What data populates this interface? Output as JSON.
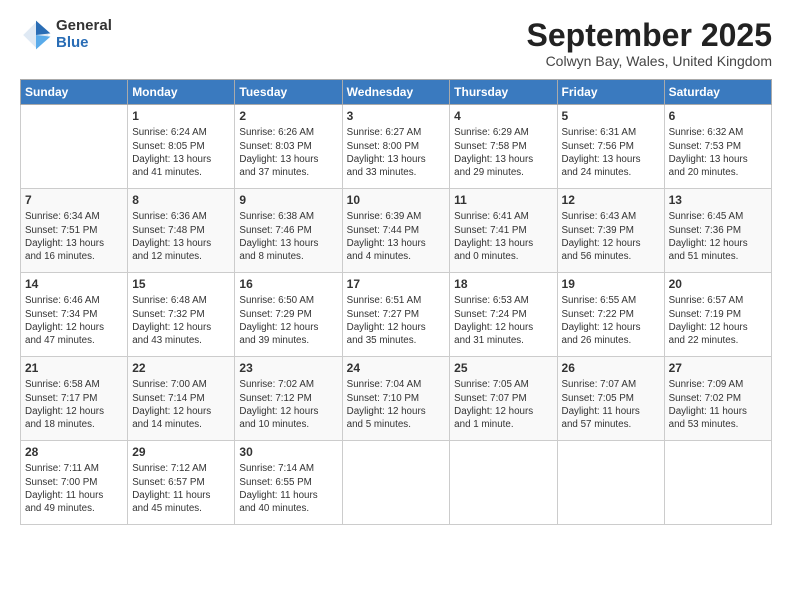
{
  "header": {
    "logo_general": "General",
    "logo_blue": "Blue",
    "month": "September 2025",
    "location": "Colwyn Bay, Wales, United Kingdom"
  },
  "weekdays": [
    "Sunday",
    "Monday",
    "Tuesday",
    "Wednesday",
    "Thursday",
    "Friday",
    "Saturday"
  ],
  "weeks": [
    [
      {
        "day": "",
        "content": ""
      },
      {
        "day": "1",
        "content": "Sunrise: 6:24 AM\nSunset: 8:05 PM\nDaylight: 13 hours\nand 41 minutes."
      },
      {
        "day": "2",
        "content": "Sunrise: 6:26 AM\nSunset: 8:03 PM\nDaylight: 13 hours\nand 37 minutes."
      },
      {
        "day": "3",
        "content": "Sunrise: 6:27 AM\nSunset: 8:00 PM\nDaylight: 13 hours\nand 33 minutes."
      },
      {
        "day": "4",
        "content": "Sunrise: 6:29 AM\nSunset: 7:58 PM\nDaylight: 13 hours\nand 29 minutes."
      },
      {
        "day": "5",
        "content": "Sunrise: 6:31 AM\nSunset: 7:56 PM\nDaylight: 13 hours\nand 24 minutes."
      },
      {
        "day": "6",
        "content": "Sunrise: 6:32 AM\nSunset: 7:53 PM\nDaylight: 13 hours\nand 20 minutes."
      }
    ],
    [
      {
        "day": "7",
        "content": "Sunrise: 6:34 AM\nSunset: 7:51 PM\nDaylight: 13 hours\nand 16 minutes."
      },
      {
        "day": "8",
        "content": "Sunrise: 6:36 AM\nSunset: 7:48 PM\nDaylight: 13 hours\nand 12 minutes."
      },
      {
        "day": "9",
        "content": "Sunrise: 6:38 AM\nSunset: 7:46 PM\nDaylight: 13 hours\nand 8 minutes."
      },
      {
        "day": "10",
        "content": "Sunrise: 6:39 AM\nSunset: 7:44 PM\nDaylight: 13 hours\nand 4 minutes."
      },
      {
        "day": "11",
        "content": "Sunrise: 6:41 AM\nSunset: 7:41 PM\nDaylight: 13 hours\nand 0 minutes."
      },
      {
        "day": "12",
        "content": "Sunrise: 6:43 AM\nSunset: 7:39 PM\nDaylight: 12 hours\nand 56 minutes."
      },
      {
        "day": "13",
        "content": "Sunrise: 6:45 AM\nSunset: 7:36 PM\nDaylight: 12 hours\nand 51 minutes."
      }
    ],
    [
      {
        "day": "14",
        "content": "Sunrise: 6:46 AM\nSunset: 7:34 PM\nDaylight: 12 hours\nand 47 minutes."
      },
      {
        "day": "15",
        "content": "Sunrise: 6:48 AM\nSunset: 7:32 PM\nDaylight: 12 hours\nand 43 minutes."
      },
      {
        "day": "16",
        "content": "Sunrise: 6:50 AM\nSunset: 7:29 PM\nDaylight: 12 hours\nand 39 minutes."
      },
      {
        "day": "17",
        "content": "Sunrise: 6:51 AM\nSunset: 7:27 PM\nDaylight: 12 hours\nand 35 minutes."
      },
      {
        "day": "18",
        "content": "Sunrise: 6:53 AM\nSunset: 7:24 PM\nDaylight: 12 hours\nand 31 minutes."
      },
      {
        "day": "19",
        "content": "Sunrise: 6:55 AM\nSunset: 7:22 PM\nDaylight: 12 hours\nand 26 minutes."
      },
      {
        "day": "20",
        "content": "Sunrise: 6:57 AM\nSunset: 7:19 PM\nDaylight: 12 hours\nand 22 minutes."
      }
    ],
    [
      {
        "day": "21",
        "content": "Sunrise: 6:58 AM\nSunset: 7:17 PM\nDaylight: 12 hours\nand 18 minutes."
      },
      {
        "day": "22",
        "content": "Sunrise: 7:00 AM\nSunset: 7:14 PM\nDaylight: 12 hours\nand 14 minutes."
      },
      {
        "day": "23",
        "content": "Sunrise: 7:02 AM\nSunset: 7:12 PM\nDaylight: 12 hours\nand 10 minutes."
      },
      {
        "day": "24",
        "content": "Sunrise: 7:04 AM\nSunset: 7:10 PM\nDaylight: 12 hours\nand 5 minutes."
      },
      {
        "day": "25",
        "content": "Sunrise: 7:05 AM\nSunset: 7:07 PM\nDaylight: 12 hours\nand 1 minute."
      },
      {
        "day": "26",
        "content": "Sunrise: 7:07 AM\nSunset: 7:05 PM\nDaylight: 11 hours\nand 57 minutes."
      },
      {
        "day": "27",
        "content": "Sunrise: 7:09 AM\nSunset: 7:02 PM\nDaylight: 11 hours\nand 53 minutes."
      }
    ],
    [
      {
        "day": "28",
        "content": "Sunrise: 7:11 AM\nSunset: 7:00 PM\nDaylight: 11 hours\nand 49 minutes."
      },
      {
        "day": "29",
        "content": "Sunrise: 7:12 AM\nSunset: 6:57 PM\nDaylight: 11 hours\nand 45 minutes."
      },
      {
        "day": "30",
        "content": "Sunrise: 7:14 AM\nSunset: 6:55 PM\nDaylight: 11 hours\nand 40 minutes."
      },
      {
        "day": "",
        "content": ""
      },
      {
        "day": "",
        "content": ""
      },
      {
        "day": "",
        "content": ""
      },
      {
        "day": "",
        "content": ""
      }
    ]
  ]
}
